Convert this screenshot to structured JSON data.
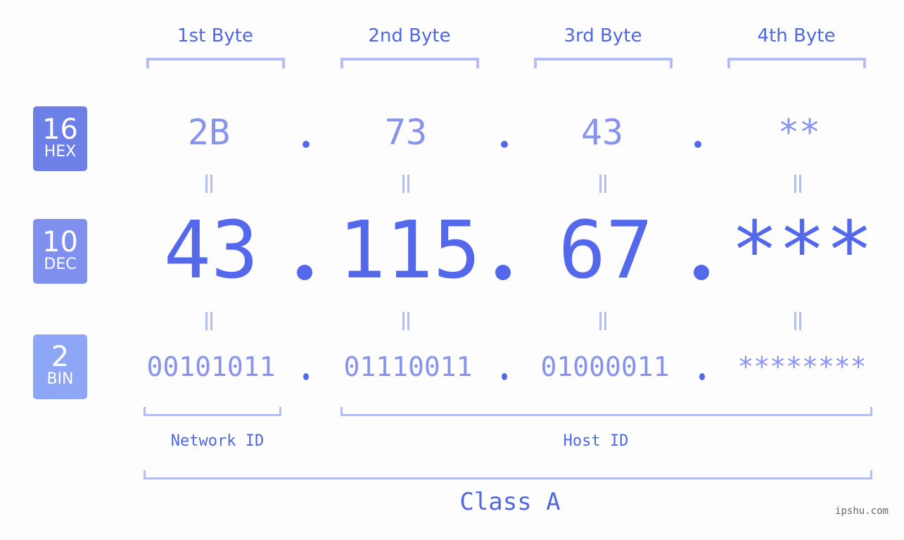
{
  "headers": [
    "1st Byte",
    "2nd Byte",
    "3rd Byte",
    "4th Byte"
  ],
  "badges": {
    "hex": {
      "num": "16",
      "label": "HEX"
    },
    "dec": {
      "num": "10",
      "label": "DEC"
    },
    "bin": {
      "num": "2",
      "label": "BIN"
    }
  },
  "hex": [
    "2B",
    "73",
    "43",
    "**"
  ],
  "dec": [
    "43",
    "115",
    "67",
    "***"
  ],
  "bin": [
    "00101011",
    "01110011",
    "01000011",
    "********"
  ],
  "network_label": "Network ID",
  "host_label": "Host ID",
  "class_label": "Class A",
  "watermark": "ipshu.com",
  "colors": {
    "accent": "#5468ec",
    "header_text": "#5068e0",
    "light_value": "#8793ec",
    "bracket": "#b3bef5",
    "badge_hex": "#6c80e8",
    "badge_dec": "#8090ee",
    "badge_bin": "#8ea6f6"
  }
}
